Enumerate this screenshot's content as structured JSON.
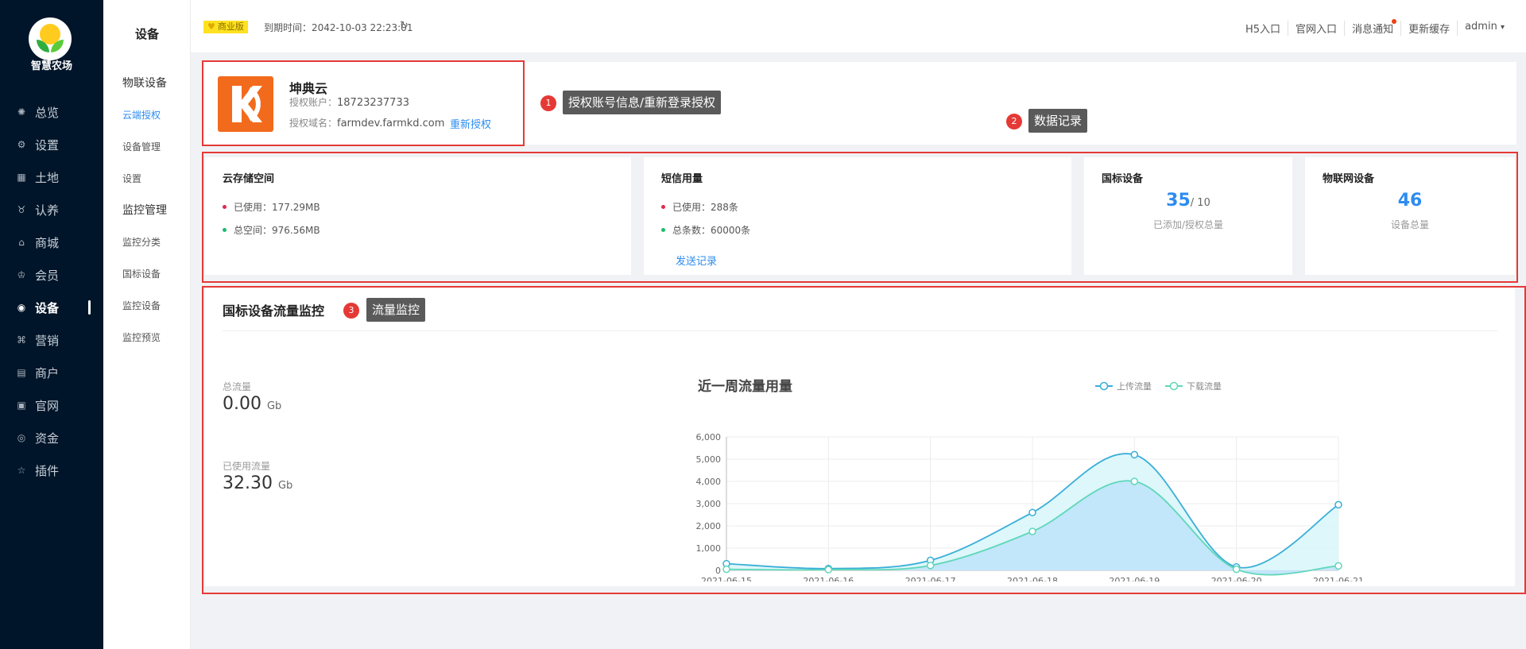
{
  "sidebar": {
    "brand": "智慧农场",
    "items": [
      {
        "label": "总览",
        "icon": "dashboard-icon"
      },
      {
        "label": "设置",
        "icon": "gear-icon"
      },
      {
        "label": "土地",
        "icon": "grid-icon"
      },
      {
        "label": "认养",
        "icon": "adopt-icon"
      },
      {
        "label": "商城",
        "icon": "shop-icon"
      },
      {
        "label": "会员",
        "icon": "member-icon"
      },
      {
        "label": "设备",
        "icon": "location-icon"
      },
      {
        "label": "营销",
        "icon": "marketing-icon"
      },
      {
        "label": "商户",
        "icon": "merchant-icon"
      },
      {
        "label": "官网",
        "icon": "website-icon"
      },
      {
        "label": "资金",
        "icon": "fund-icon"
      },
      {
        "label": "插件",
        "icon": "star-icon"
      }
    ],
    "active_index": 6
  },
  "submenu": {
    "title": "设备",
    "items": [
      {
        "label": "物联设备",
        "group": true
      },
      {
        "label": "云端授权",
        "active": true
      },
      {
        "label": "设备管理"
      },
      {
        "label": "设置"
      },
      {
        "label": "监控管理",
        "group": true
      },
      {
        "label": "监控分类"
      },
      {
        "label": "国标设备"
      },
      {
        "label": "监控设备"
      },
      {
        "label": "监控预览"
      }
    ]
  },
  "topbar": {
    "badge": "商业版",
    "expire_text": "到期时间：2042-10-03 22:23:01",
    "links": [
      "H5入口",
      "官网入口",
      "消息通知",
      "更新缓存",
      "admin"
    ],
    "user_caret": "▾"
  },
  "auth": {
    "name": "坤典云",
    "account_label": "授权账户：",
    "account": "18723237733",
    "domain_label": "授权域名：",
    "domain": "farmdev.farmkd.com",
    "relink": "重新授权"
  },
  "annotations": [
    {
      "num": "1",
      "text": "授权账号信息/重新登录授权"
    },
    {
      "num": "2",
      "text": "数据记录"
    },
    {
      "num": "3",
      "text": "流量监控"
    }
  ],
  "stats": {
    "storage": {
      "title": "云存储空间",
      "used": "已使用：177.29MB",
      "total": "总空间：976.56MB"
    },
    "sms": {
      "title": "短信用量",
      "used": "已使用：288条",
      "total": "总条数：60000条",
      "link": "发送记录"
    },
    "gb": {
      "title": "国标设备",
      "value": "35",
      "limit": "/ 10",
      "sub": "已添加/授权总量"
    },
    "iot": {
      "title": "物联网设备",
      "value": "46",
      "sub": "设备总量"
    }
  },
  "flow": {
    "title": "国标设备流量监控",
    "total_label": "总流量",
    "total_value": "0.00",
    "total_unit": "Gb",
    "used_label": "已使用流量",
    "used_value": "32.30",
    "used_unit": "Gb"
  },
  "chart_data": {
    "type": "area",
    "title": "近一周流量用量",
    "categories": [
      "2021-06-15",
      "2021-06-16",
      "2021-06-17",
      "2021-06-18",
      "2021-06-19",
      "2021-06-20",
      "2021-06-21"
    ],
    "series": [
      {
        "name": "上传流量",
        "values": [
          300,
          80,
          450,
          2600,
          5200,
          150,
          2950
        ],
        "color": "#3aaed8"
      },
      {
        "name": "下载流量",
        "values": [
          50,
          30,
          220,
          1750,
          4000,
          50,
          200
        ],
        "color": "#5fd7b8"
      }
    ],
    "ylim": [
      0,
      6000
    ],
    "yticks": [
      "0",
      "1,000",
      "2,000",
      "3,000",
      "4,000",
      "5,000",
      "6,000"
    ],
    "grid": true,
    "legend": "top-center"
  }
}
